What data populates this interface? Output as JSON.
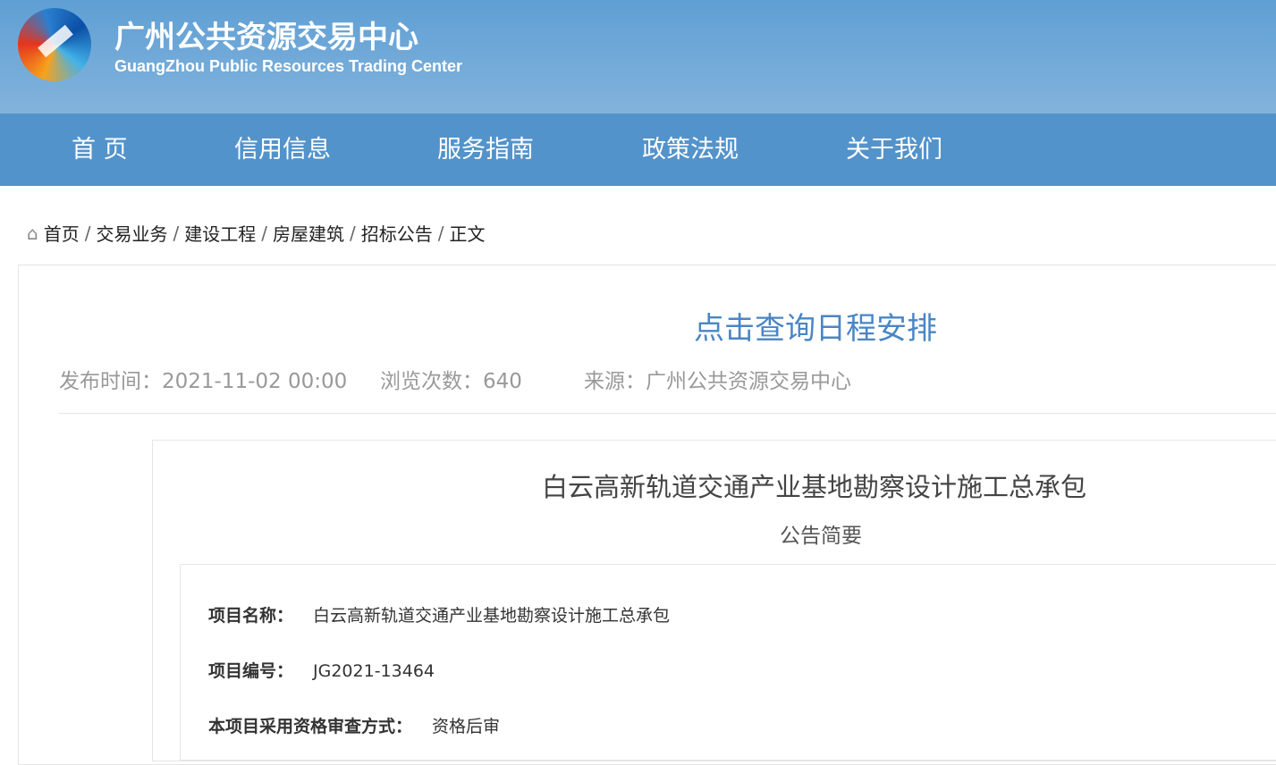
{
  "header": {
    "title_cn": "广州公共资源交易中心",
    "title_en": "GuangZhou Public Resources Trading Center"
  },
  "nav": [
    "首 页",
    "信用信息",
    "服务指南",
    "政策法规",
    "关于我们"
  ],
  "breadcrumb": [
    "首页",
    "交易业务",
    "建设工程",
    "房屋建筑",
    "招标公告",
    "正文"
  ],
  "schedule_link": "点击查询日程安排",
  "meta": {
    "publish": "发布时间：2021-11-02 00:00",
    "views": "浏览次数：640",
    "source": "来源：广州公共资源交易中心"
  },
  "notice": {
    "title": "白云高新轨道交通产业基地勘察设计施工总承包",
    "subtitle": "公告简要",
    "fields": [
      {
        "label": "项目名称：",
        "value": "白云高新轨道交通产业基地勘察设计施工总承包"
      },
      {
        "label": "项目编号：",
        "value": "JG2021-13464"
      },
      {
        "label": "本项目采用资格审查方式：",
        "value": "资格后审"
      }
    ]
  }
}
